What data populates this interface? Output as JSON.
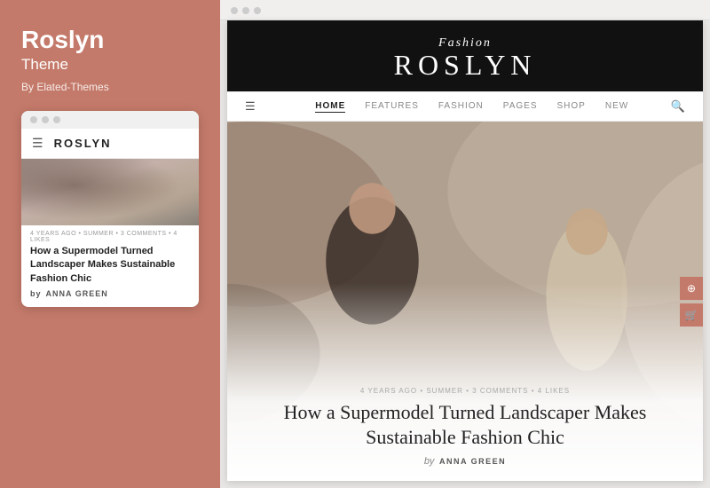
{
  "leftPanel": {
    "themeTitle": "Roslyn",
    "themeSubtitle": "Theme",
    "themeAuthor": "By Elated-Themes"
  },
  "mobileCard": {
    "logo": "ROSLYN",
    "articleMeta": "4 YEARS AGO  •  SUMMER  •  3 COMMENTS  •  4 LIKES",
    "articleTitle": "How a Supermodel Turned Landscaper Makes Sustainable Fashion Chic",
    "bylinePrefix": "by",
    "bylineAuthor": "ANNA GREEN"
  },
  "website": {
    "logoTop": "Fashion",
    "logoMain": "ROSLYN",
    "nav": {
      "items": [
        {
          "label": "HOME",
          "active": true
        },
        {
          "label": "FEATURES",
          "active": false
        },
        {
          "label": "FASHION",
          "active": false
        },
        {
          "label": "PAGES",
          "active": false
        },
        {
          "label": "SHOP",
          "active": false
        },
        {
          "label": "NEW",
          "active": false
        }
      ]
    },
    "heroMeta": "4 YEARS AGO  •  SUMMER  •  3 COMMENTS  •  4 LIKES",
    "heroTitle": "How a Supermodel Turned Landscaper Makes Sustainable Fashion Chic",
    "heroBylinePrefix": "by",
    "heroBylineAuthor": "ANNA GREEN"
  },
  "browserDots": [
    "dot1",
    "dot2",
    "dot3"
  ],
  "titlebarDots": [
    "d1",
    "d2",
    "d3"
  ]
}
